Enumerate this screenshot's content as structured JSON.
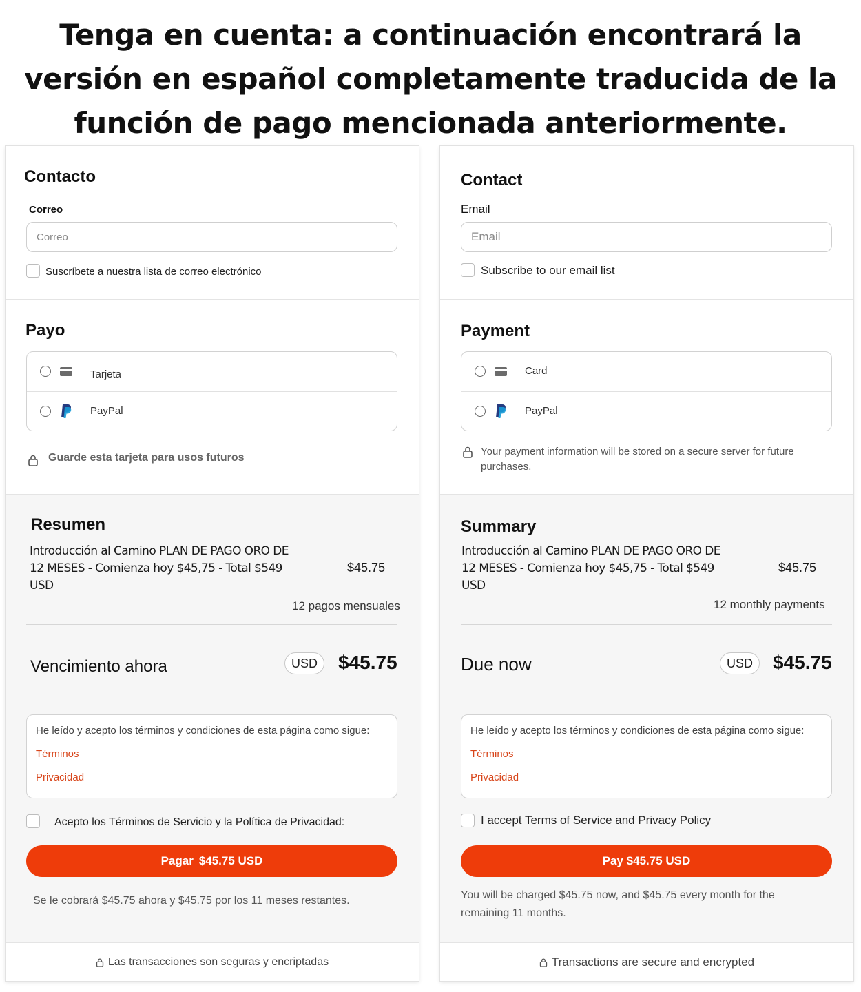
{
  "banner": {
    "text": "Tenga en cuenta: a continuación encontrará la versión en español completamente traducida de la función de pago mencionada anteriormente."
  },
  "spanish": {
    "contact": {
      "heading": "Contacto",
      "email_label": "Correo",
      "email_placeholder": "Correo",
      "subscribe_label": "Suscríbete a nuestra lista de correo electrónico"
    },
    "payment": {
      "heading": "Payo",
      "card_label": "Tarjeta",
      "paypal_label": "PayPal",
      "save_note": "Guarde esta tarjeta para usos futuros"
    },
    "summary": {
      "heading": "Resumen",
      "item_name": "Introducción al Camino PLAN DE PAGO ORO DE 12 MESES - Comienza hoy $45,75 - Total $549 USD",
      "item_price": "$45.75",
      "subtext": "12 pagos mensuales",
      "due_label": "Vencimiento ahora",
      "currency": "USD",
      "due_amount": "$45.75",
      "terms_intro": "He leído y acepto los términos y condiciones de esta página como sigue:",
      "terms_link": "Términos",
      "privacy_link": "Privacidad",
      "accept_label": "Acepto los Términos de Servicio y la Política de Privacidad:",
      "pay_button_prefix": "Pagar",
      "pay_button_amount": "$45.75 USD",
      "charge_note": "Se le cobrará $45.75 ahora y $45.75 por los 11 meses restantes."
    },
    "footer": "Las transacciones son seguras y encriptadas"
  },
  "english": {
    "contact": {
      "heading": "Contact",
      "email_label": "Email",
      "email_placeholder": "Email",
      "subscribe_label": "Subscribe to our email list"
    },
    "payment": {
      "heading": "Payment",
      "card_label": "Card",
      "paypal_label": "PayPal",
      "save_note": "Your payment information will be stored on a secure server for future purchases."
    },
    "summary": {
      "heading": "Summary",
      "item_name": "Introducción al Camino PLAN DE PAGO ORO DE 12 MESES - Comienza hoy $45,75 - Total $549 USD",
      "item_price": "$45.75",
      "subtext": "12 monthly payments",
      "due_label": "Due now",
      "currency": "USD",
      "due_amount": "$45.75",
      "terms_intro": "He leído y acepto los términos y condiciones de esta página como sigue:",
      "terms_link": "Términos",
      "privacy_link": "Privacidad",
      "accept_label": "I accept Terms of Service and Privacy Policy",
      "pay_button_label": "Pay $45.75 USD",
      "charge_note": "You will be charged $45.75 now, and $45.75 every month for the remaining 11 months."
    },
    "footer": "Transactions are secure and encrypted"
  },
  "colors": {
    "accent": "#ee3c0a",
    "link": "#d8461b",
    "summary_bg": "#f6f6f6",
    "paypal_dark": "#253b80",
    "paypal_light": "#179bd7"
  },
  "icons": [
    "credit-card-icon",
    "paypal-icon",
    "lock-icon"
  ]
}
